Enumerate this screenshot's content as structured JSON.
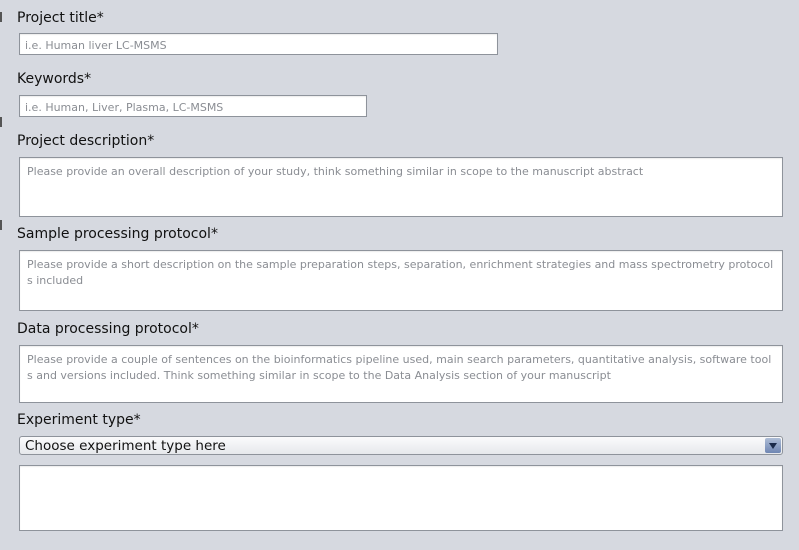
{
  "form": {
    "project_title": {
      "label": "Project title*",
      "placeholder": "i.e. Human liver LC-MSMS"
    },
    "keywords": {
      "label": "Keywords*",
      "placeholder": "i.e. Human, Liver, Plasma, LC-MSMS"
    },
    "project_description": {
      "label": "Project description*",
      "placeholder": "Please provide an overall description of your study, think something similar in scope to the manuscript abstract"
    },
    "sample_processing": {
      "label": "Sample processing protocol*",
      "placeholder": "Please provide a short description on the sample preparation steps, separation, enrichment strategies and mass spectrometry protocols included"
    },
    "data_processing": {
      "label": "Data processing protocol*",
      "placeholder": "Please provide a couple of sentences on the bioinformatics pipeline used, main search parameters, quantitative analysis, software tools and versions included. Think something similar in scope to the Data Analysis section of your manuscript"
    },
    "experiment_type": {
      "label": "Experiment type*",
      "selected": "Choose experiment type here"
    }
  },
  "colors": {
    "background": "#d6d9e0",
    "field_border": "#8e939b",
    "placeholder": "#8a8d93",
    "combo_arrow": "#6f86b3"
  }
}
